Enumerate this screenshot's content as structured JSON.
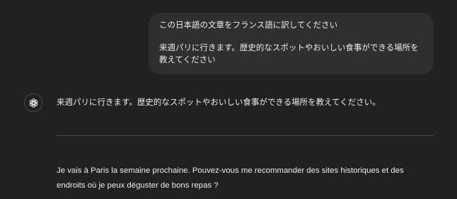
{
  "user_message": {
    "line1": "この日本語の文章をフランス語に訳してください",
    "line2": "来週パリに行きます。歴史的なスポットやおいしい食事ができる場所を教えてください"
  },
  "assistant": {
    "avatar_icon": "openai-logo-icon",
    "response_japanese": "来週パリに行きます。歴史的なスポットやおいしい食事ができる場所を教えてください。",
    "response_french": "Je vais à Paris la semaine prochaine. Pouvez-vous me recommander des sites historiques et des endroits où je peux déguster de bons repas ?"
  }
}
